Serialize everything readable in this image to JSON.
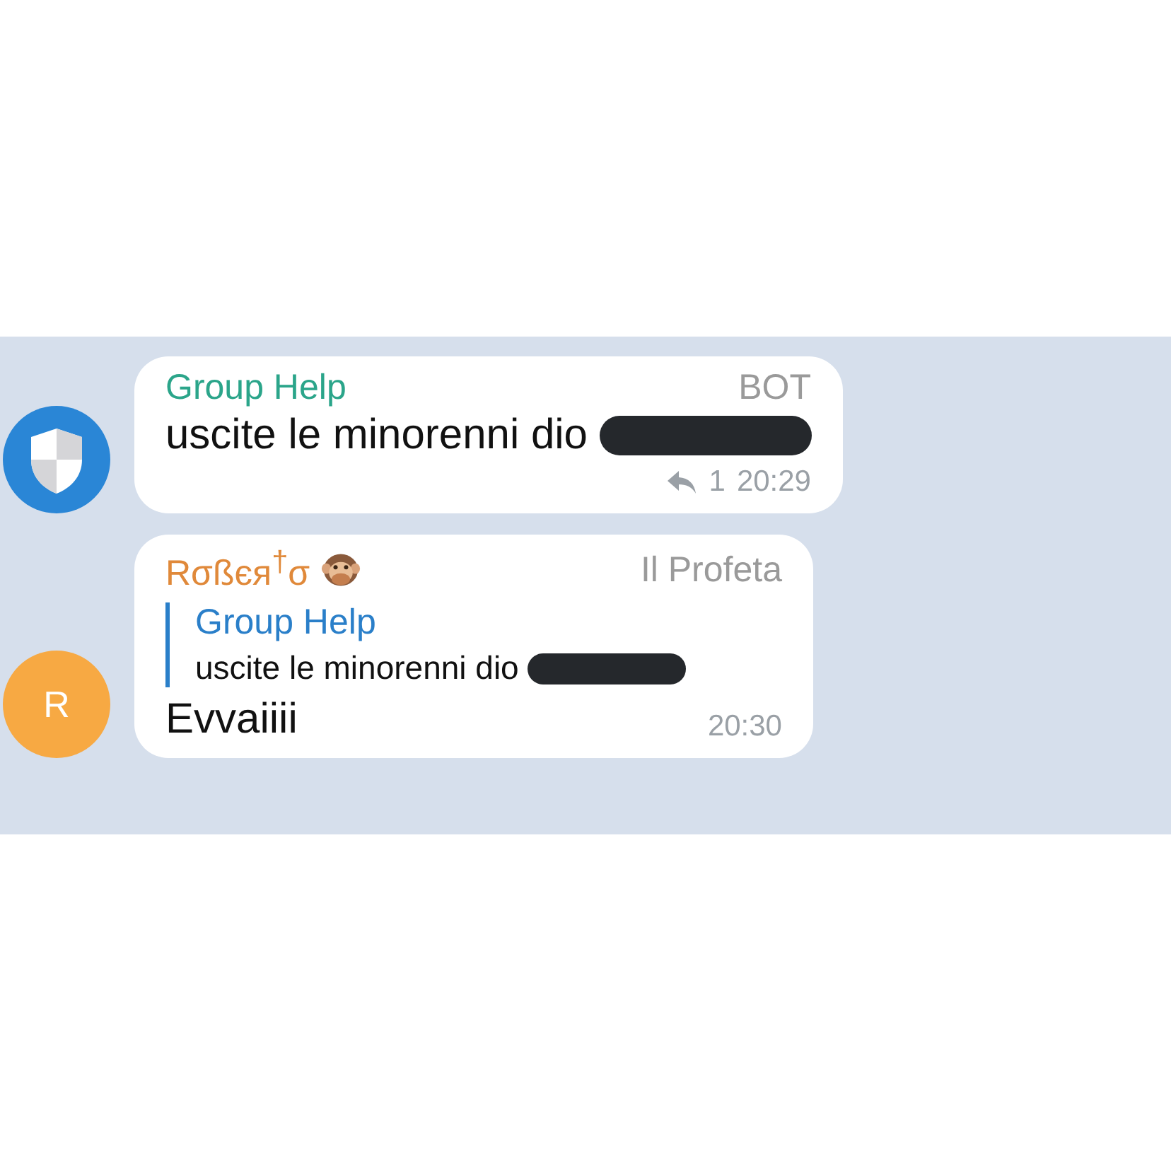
{
  "messages": [
    {
      "avatar": {
        "kind": "shield"
      },
      "sender": "Group Help",
      "color": "#2ba58a",
      "role": "BOT",
      "text": "uscite le minorenni dio",
      "redacted": true,
      "replies": "1",
      "time": "20:29"
    },
    {
      "avatar": {
        "kind": "letter",
        "letter": "R",
        "color": "#f7a943"
      },
      "sender": "Rσßєя$^{†}$σ",
      "sender_emoji": true,
      "color": "#e0893a",
      "role": "Il Profeta",
      "quote": {
        "sender": "Group Help",
        "text": "uscite le minorenni dio",
        "redacted": true
      },
      "text": "Evvaiiii",
      "time": "20:30"
    }
  ]
}
